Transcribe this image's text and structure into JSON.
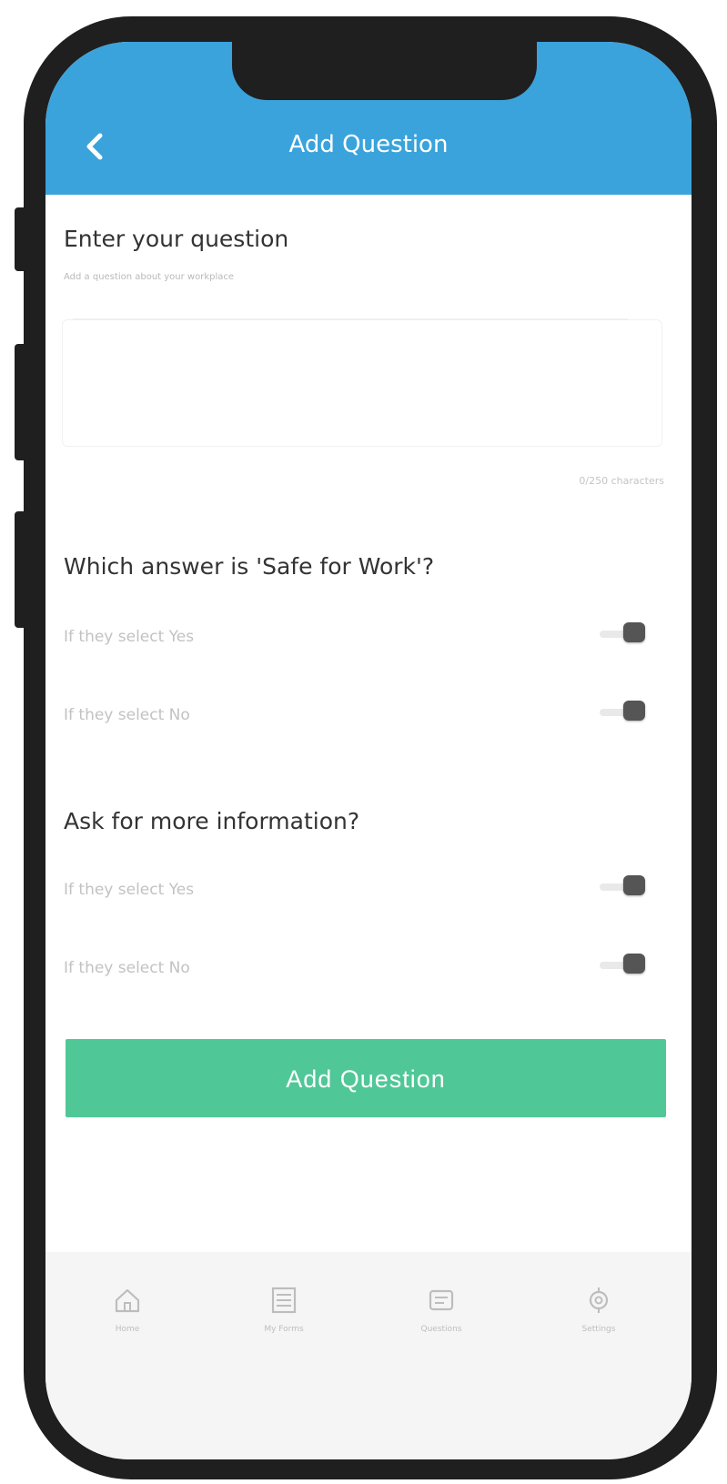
{
  "header": {
    "title": "Add Question",
    "background_color": "#3aa3dc"
  },
  "question": {
    "label": "Enter your question",
    "hint": "Add a question about your workplace",
    "value": "",
    "counter": "0/250 characters"
  },
  "safe_for_work": {
    "title": "Which answer is 'Safe for Work'?",
    "options": [
      {
        "label": "If they select Yes"
      },
      {
        "label": "If they select No"
      }
    ]
  },
  "more_info": {
    "title": "Ask for more information?",
    "options": [
      {
        "label": "If they select Yes"
      },
      {
        "label": "If they select No"
      }
    ]
  },
  "submit": {
    "label": "Add Question",
    "color": "#50c797"
  },
  "bottom_nav": {
    "items": [
      {
        "label": "Home",
        "icon": "home-icon"
      },
      {
        "label": "My Forms",
        "icon": "forms-icon"
      },
      {
        "label": "Questions",
        "icon": "questions-icon"
      },
      {
        "label": "Settings",
        "icon": "settings-icon"
      }
    ]
  }
}
